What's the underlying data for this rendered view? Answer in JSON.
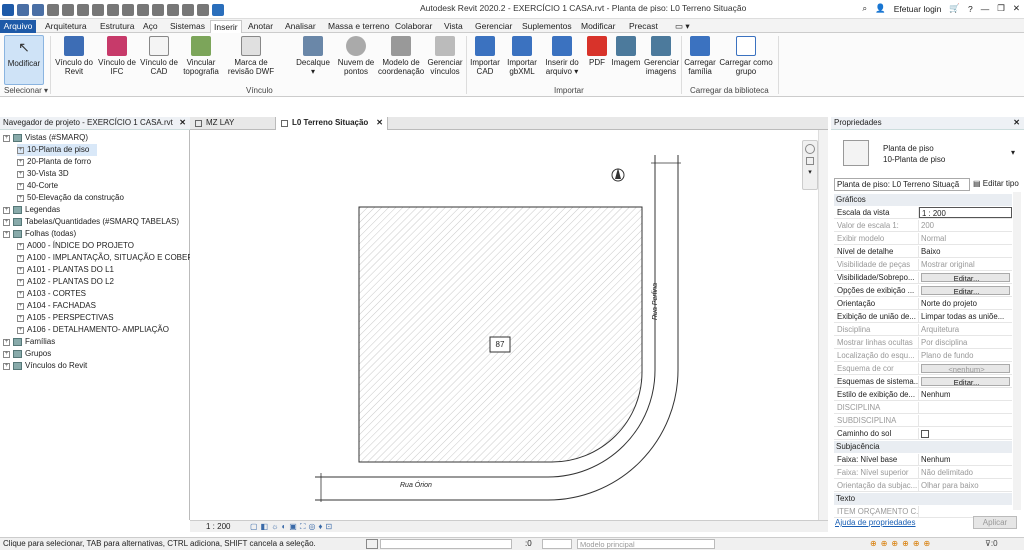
{
  "title": "Autodesk Revit 2020.2 - EXERCÍCIO 1 CASA.rvt - Planta de piso: L0 Terreno Situação",
  "right_controls": {
    "login": "Efetuar login"
  },
  "ribbon_tabs": [
    "Arquivo",
    "Arquitetura",
    "Estrutura",
    "Aço",
    "Sistemas",
    "Inserir",
    "Anotar",
    "Analisar",
    "Massa e terreno",
    "Colaborar",
    "Vista",
    "Gerenciar",
    "Suplementos",
    "Modificar",
    "Precast"
  ],
  "ribbon": {
    "modify": "Modificar",
    "select": "Selecionar",
    "vinculo_buttons": [
      "Vínculo do Revit",
      "Vínculo de IFC",
      "Vínculo de CAD",
      "Vincular topografia",
      "Marca de revisão DWF",
      "Decalque",
      "Nuvem de pontos",
      "Modelo de coordenação",
      "Gerenciar vínculos"
    ],
    "vinculo_label": "Vínculo",
    "importar_buttons": [
      "Importar CAD",
      "Importar gbXML",
      "Inserir do arquivo",
      "PDF",
      "Imagem",
      "Gerenciar imagens"
    ],
    "importar_label": "Importar",
    "biblioteca_buttons": [
      "Carregar família",
      "Carregar como grupo"
    ],
    "biblioteca_label": "Carregar da biblioteca"
  },
  "browser": {
    "title": "Navegador de projeto - EXERCÍCIO 1 CASA.rvt",
    "items": [
      {
        "label": "Vistas (#SMARQ)",
        "level": 0
      },
      {
        "label": "10-Planta de piso",
        "level": 1,
        "selected": true
      },
      {
        "label": "20-Planta de forro",
        "level": 1
      },
      {
        "label": "30-Vista 3D",
        "level": 1
      },
      {
        "label": "40-Corte",
        "level": 1
      },
      {
        "label": "50-Elevação da construção",
        "level": 1
      },
      {
        "label": "Legendas",
        "level": 0
      },
      {
        "label": "Tabelas/Quantidades (#SMARQ TABELAS)",
        "level": 0
      },
      {
        "label": "Folhas (todas)",
        "level": 0
      },
      {
        "label": "A000 - ÍNDICE DO PROJETO",
        "level": 1
      },
      {
        "label": "A100 - IMPLANTAÇÃO, SITUAÇÃO E COBERT",
        "level": 1
      },
      {
        "label": "A101 - PLANTAS DO L1",
        "level": 1
      },
      {
        "label": "A102 - PLANTAS DO L2",
        "level": 1
      },
      {
        "label": "A103 - CORTES",
        "level": 1
      },
      {
        "label": "A104 - FACHADAS",
        "level": 1
      },
      {
        "label": "A105 - PERSPECTIVAS",
        "level": 1
      },
      {
        "label": "A106 - DETALHAMENTO- AMPLIAÇÃO",
        "level": 1
      },
      {
        "label": "Famílias",
        "level": 0
      },
      {
        "label": "Grupos",
        "level": 0
      },
      {
        "label": "Vínculos do Revit",
        "level": 0
      }
    ]
  },
  "view_tabs": [
    "MZ LAY",
    "L0 Terreno Situação"
  ],
  "canvas": {
    "lot_number": "87",
    "street1": "Rua Órion",
    "street2": "Rua Perfina"
  },
  "view_control": {
    "scale": "1 : 200"
  },
  "properties": {
    "title": "Propriedades",
    "type_name": "Planta de piso",
    "type_sub": "10-Planta de piso",
    "selector": "Planta de piso: L0 Terreno Situaçã",
    "edit_type": "Editar tipo",
    "help": "Ajuda de propriedades",
    "apply": "Aplicar",
    "sections": {
      "graficos": "Gráficos",
      "subjacencia": "Subjacência",
      "texto": "Texto"
    },
    "rows_graficos": [
      {
        "k": "Escala da vista",
        "v": "1 : 200"
      },
      {
        "k": "Valor de escala    1:",
        "v": "200",
        "dis": true
      },
      {
        "k": "Exibir modelo",
        "v": "Normal",
        "dis": true
      },
      {
        "k": "Nível de detalhe",
        "v": "Baixo"
      },
      {
        "k": "Visibilidade de peças",
        "v": "Mostrar original",
        "dis": true
      },
      {
        "k": "Visibilidade/Sobrepo...",
        "v": "Editar...",
        "btn": true
      },
      {
        "k": "Opções de exibição ...",
        "v": "Editar...",
        "btn": true
      },
      {
        "k": "Orientação",
        "v": "Norte do projeto"
      },
      {
        "k": "Exibição de união de...",
        "v": "Limpar todas as uniõe..."
      },
      {
        "k": "Disciplina",
        "v": "Arquitetura",
        "dis": true
      },
      {
        "k": "Mostrar linhas ocultas",
        "v": "Por disciplina",
        "dis": true
      },
      {
        "k": "Localização do esqu...",
        "v": "Plano de fundo",
        "dis": true
      },
      {
        "k": "Esquema de cor",
        "v": "<nenhum>",
        "btn": true,
        "dis": true
      },
      {
        "k": "Esquemas de sistema...",
        "v": "Editar...",
        "btn": true
      },
      {
        "k": "Estilo de exibição de...",
        "v": "Nenhum"
      },
      {
        "k": "DISCIPLINA",
        "v": "",
        "dis": true
      },
      {
        "k": "SUBDISCIPLINA",
        "v": "",
        "dis": true
      },
      {
        "k": "Caminho do sol",
        "v": "",
        "check": true
      }
    ],
    "rows_subj": [
      {
        "k": "Faixa: Nível base",
        "v": "Nenhum"
      },
      {
        "k": "Faixa: Nível superior",
        "v": "Não delimitado",
        "dis": true
      },
      {
        "k": "Orientação da subjac...",
        "v": "Olhar para baixo",
        "dis": true
      }
    ],
    "rows_texto": [
      {
        "k": "ITEM ORÇAMENTO C...",
        "v": "",
        "dis": true
      }
    ]
  },
  "status": {
    "text": "Clique para selecionar, TAB para alternativas, CTRL adiciona, SHIFT cancela a seleção.",
    "coord": ":0",
    "model": "Modelo principal",
    "filter": ":0"
  }
}
